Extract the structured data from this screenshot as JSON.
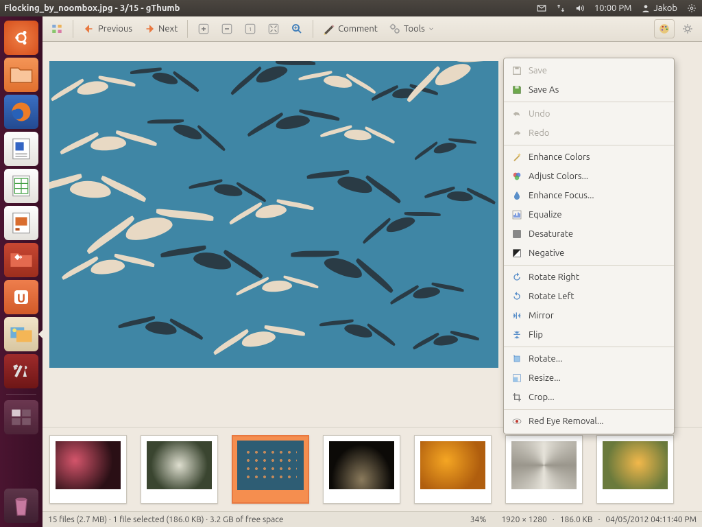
{
  "menubar": {
    "title": "Flocking_by_noombox.jpg - 3/15 - gThumb",
    "time": "10:00 PM",
    "user": "Jakob"
  },
  "toolbar": {
    "previous": "Previous",
    "next": "Next",
    "comment": "Comment",
    "tools": "Tools"
  },
  "tools_menu": {
    "save": "Save",
    "save_as": "Save As",
    "undo": "Undo",
    "redo": "Redo",
    "enhance_colors": "Enhance Colors",
    "adjust_colors": "Adjust Colors...",
    "enhance_focus": "Enhance Focus...",
    "equalize": "Equalize",
    "desaturate": "Desaturate",
    "negative": "Negative",
    "rotate_right": "Rotate Right",
    "rotate_left": "Rotate Left",
    "mirror": "Mirror",
    "flip": "Flip",
    "rotate": "Rotate...",
    "resize": "Resize...",
    "crop": "Crop...",
    "red_eye": "Red Eye Removal..."
  },
  "status": {
    "left": "15 files (2.7 MB) · 1 file selected (186.0 KB) · 3.2 GB of free space",
    "zoom": "34%",
    "dims": "1920 × 1280",
    "size": "186.0 KB",
    "date": "04/05/2012 04:11:40 PM"
  },
  "thumbnails": {
    "count": 7,
    "selected_index": 2
  }
}
